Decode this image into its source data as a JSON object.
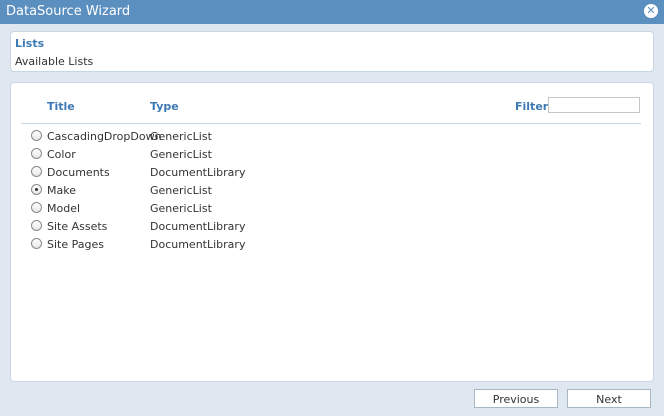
{
  "window": {
    "title": "DataSource Wizard"
  },
  "header": {
    "title": "Lists",
    "subtitle": "Available Lists"
  },
  "table": {
    "columns": [
      "Title",
      "Type"
    ],
    "filter_label": "Filter",
    "filter_value": "",
    "rows": [
      {
        "title": "CascadingDropDown",
        "type": "GenericList",
        "selected": false
      },
      {
        "title": "Color",
        "type": "GenericList",
        "selected": false
      },
      {
        "title": "Documents",
        "type": "DocumentLibrary",
        "selected": false
      },
      {
        "title": "Make",
        "type": "GenericList",
        "selected": true
      },
      {
        "title": "Model",
        "type": "GenericList",
        "selected": false
      },
      {
        "title": "Site Assets",
        "type": "DocumentLibrary",
        "selected": false
      },
      {
        "title": "Site Pages",
        "type": "DocumentLibrary",
        "selected": false
      }
    ]
  },
  "footer": {
    "previous_label": "Previous",
    "next_label": "Next"
  }
}
